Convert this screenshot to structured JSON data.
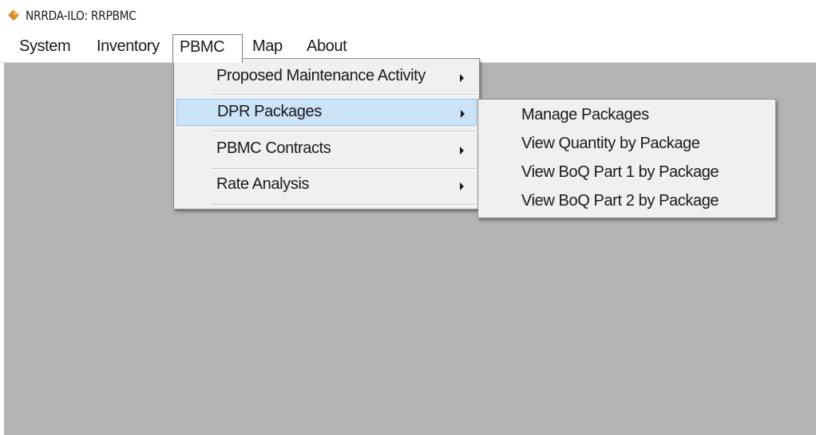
{
  "window": {
    "title": "NRRDA-ILO: RRPBMC",
    "icon": "diamond-app-icon",
    "icon_color": "#d98b2b"
  },
  "menubar": {
    "items": [
      {
        "label": "System"
      },
      {
        "label": "Inventory"
      },
      {
        "label": "PBMC",
        "active": true
      },
      {
        "label": "Map"
      },
      {
        "label": "About"
      }
    ]
  },
  "pbmc_menu": {
    "items": [
      {
        "label": "Proposed Maintenance Activity",
        "has_submenu": true
      },
      {
        "label": "DPR Packages",
        "has_submenu": true,
        "highlighted": true
      },
      {
        "label": "PBMC Contracts",
        "has_submenu": true
      },
      {
        "label": "Rate Analysis",
        "has_submenu": true
      }
    ],
    "highlight_color": "#cce4f7"
  },
  "dpr_submenu": {
    "items": [
      {
        "label": "Manage Packages"
      },
      {
        "label": "View Quantity by Package"
      },
      {
        "label": "View BoQ Part 1 by Package"
      },
      {
        "label": "View BoQ Part 2 by Package"
      }
    ]
  },
  "client_area_color": "#b3b3b3"
}
